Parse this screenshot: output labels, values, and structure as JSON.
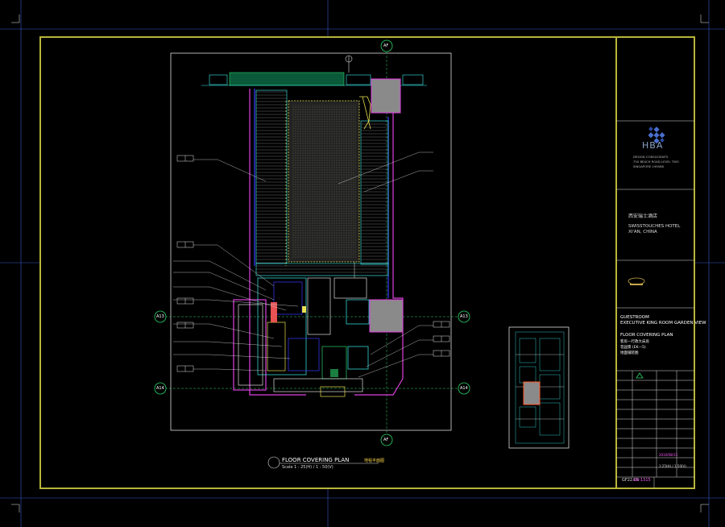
{
  "drawing": {
    "title": "FLOOR COVERING PLAN",
    "title_cn": "地毯平面图",
    "scale": "Scale 1 : 25(H) / 1 : 50(V)",
    "grid_labels": {
      "top": "AF",
      "bottom": "AF",
      "left_upper": "A13",
      "left_lower": "A14",
      "right_upper": "A13",
      "right_lower": "A14"
    }
  },
  "title_block": {
    "consultant": {
      "logo_text": "HBA",
      "line1": "DESIGN CONSULTANTS",
      "line2": "750 BEACH ROAD LEVEL TWO",
      "line3": "SINGAPORE 199588"
    },
    "project": {
      "name_cn": "西安瑞士酒店",
      "name_en1": "SWISSTOUCHES HOTEL",
      "name_en2": "XI'AN, CHINA"
    },
    "drawing_info": {
      "room_line1": "GUESTROOM",
      "room_line2": "EXECUTIVE KING ROOM GARDEN VIEW",
      "dwg_line1": "FLOOR COVERING PLAN",
      "dwg_line2": "客房—行政大床房",
      "dwg_line3": "花园景 (EK—5)",
      "dwg_line4": "地面铺装图"
    },
    "date": "2010/08/13",
    "scale": "1:25(H) / 1:50(V)",
    "sheet_code": "GF22.05",
    "project_no": "GR-1315"
  },
  "colors": {
    "frame": "#b8b43a",
    "cyan": "#3cf0f0",
    "blue": "#3a3aff",
    "magenta": "#e040e0",
    "green": "#2cd46a",
    "yellow": "#e8e050",
    "grey": "#808080"
  }
}
